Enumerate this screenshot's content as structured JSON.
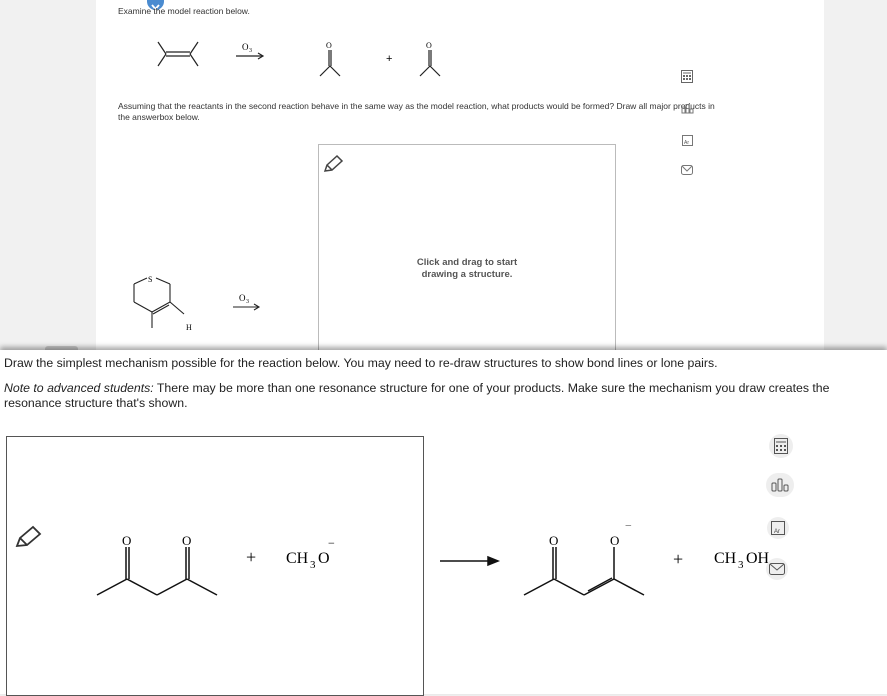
{
  "top": {
    "intro_text": "Examine the model reaction below.",
    "reagent_o3": "O",
    "reagent_o3_sub": "3",
    "plus": "+",
    "question_line1": "Assuming that the reactants in the second reaction behave in the same way as the model reaction, what products would be formed? Draw all major products in",
    "question_line2": "the answerbox below.",
    "hint_line1": "Click and drag to start",
    "hint_line2": "drawing a structure.",
    "atom_s": "S",
    "atom_h": "H",
    "reagent2_o3": "O",
    "reagent2_o3_sub": "3"
  },
  "bottom": {
    "instruction": "Draw the simplest mechanism possible for the reaction below. You may need to re-draw structures to show bond lines or lone pairs.",
    "note_label": "Note to advanced students:",
    "note_text": " There may be more than one resonance structure for one of your products. Make sure the mechanism you draw creates the resonance structure that's shown.",
    "plus1": "+",
    "methoxide": "CH",
    "methoxide_sub": "3",
    "methoxide_o": "O",
    "methoxide_charge": "−",
    "plus2": "+",
    "methanol": "CH",
    "methanol_sub": "3",
    "methanol_oh": "OH",
    "enolate_charge": "−",
    "atom_o": "O"
  },
  "icons": [
    "pencil-icon",
    "calculator-icon",
    "periodic-table-icon",
    "chart-icon",
    "mail-icon",
    "chevron-down-icon"
  ]
}
